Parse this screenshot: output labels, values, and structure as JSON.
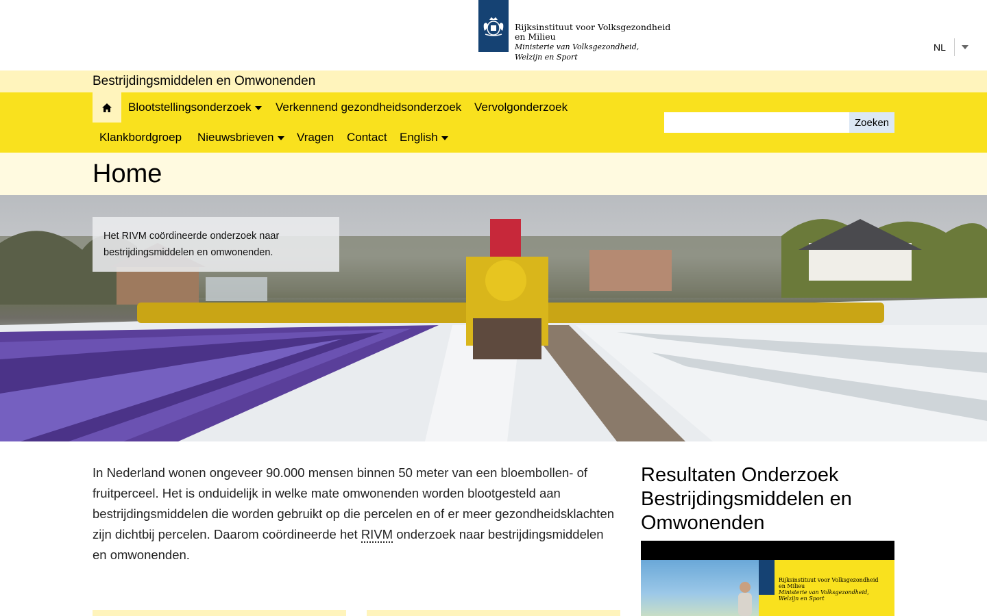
{
  "header": {
    "logo_line1": "Rijksinstituut voor Volksgezondheid",
    "logo_line2": "en Milieu",
    "logo_line3": "Ministerie van Volksgezondheid,",
    "logo_line4": "Welzijn en Sport",
    "language": "NL"
  },
  "site": {
    "title": "Bestrijdingsmiddelen en Omwonenden"
  },
  "nav": {
    "items": [
      {
        "label": "Blootstellingsonderzoek"
      },
      {
        "label": "Verkennend gezondheidsonderzoek"
      },
      {
        "label": "Vervolgonderzoek"
      },
      {
        "label": "Klankbordgroep"
      },
      {
        "label": "Nieuwsbrieven"
      },
      {
        "label": "Vragen"
      },
      {
        "label": "Contact"
      },
      {
        "label": "English"
      }
    ],
    "search_button": "Zoeken",
    "search_value": ""
  },
  "page": {
    "title": "Home"
  },
  "hero": {
    "caption": "Het RIVM coördineerde onderzoek naar bestrijdingsmiddelen en omwonenden."
  },
  "content": {
    "intro_before": "In Nederland wonen ongeveer 90.000 mensen binnen 50 meter van een bloembollen- of fruitperceel. Het is onduidelijk in welke mate omwonenden worden blootgesteld aan bestrijdingsmiddelen die worden gebruikt op die percelen en of er meer gezondheidsklachten zijn dichtbij percelen. Daarom coördineerde het ",
    "intro_abbr": "RIVM",
    "intro_after": " onderzoek naar bestrijdingsmiddelen en omwonenden."
  },
  "sidebar": {
    "title": "Resultaten Onderzoek Bestrijdingsmiddelen en Omwonenden",
    "thumb_line1": "Rijksinstituut voor Volksgezondheid",
    "thumb_line2": "en Milieu",
    "thumb_line3": "Ministerie van Volksgezondheid,",
    "thumb_line4": "Welzijn en Sport"
  },
  "colors": {
    "brand_blue": "#154273",
    "nav_yellow": "#f9e11e",
    "light_yellow": "#fff4bc"
  },
  "icons": {
    "home": "home-icon",
    "caret": "chevron-down-icon",
    "crest": "crest-icon"
  }
}
